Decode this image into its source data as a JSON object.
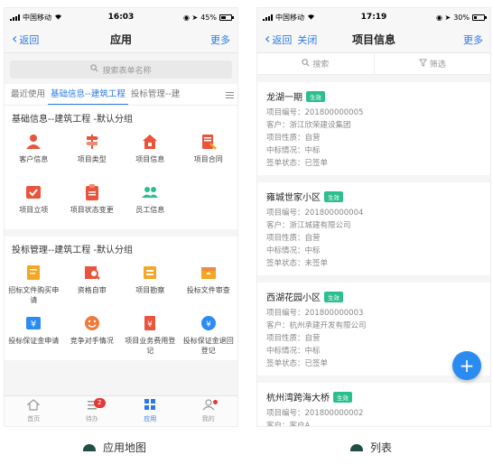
{
  "left": {
    "status": {
      "carrier": "中国移动",
      "time": "16:03",
      "battery": "45%",
      "battery_level": 0.45
    },
    "nav": {
      "back": "返回",
      "title": "应用",
      "more": "更多"
    },
    "search_placeholder": "搜索表单名称",
    "tabs": [
      "最近使用",
      "基础信息--建筑工程",
      "投标管理--建"
    ],
    "section1": {
      "title": "基础信息--建筑工程 -默认分组",
      "items": [
        "客户信息",
        "项目类型",
        "项目信息",
        "项目合同",
        "项目立项",
        "项目状态变更",
        "员工信息"
      ]
    },
    "section2": {
      "title": "投标管理--建筑工程 -默认分组",
      "items": [
        "招标文件购买申请",
        "资格自审",
        "项目勘察",
        "投标文件审查",
        "投标保证金申请",
        "竞争对手情况",
        "项目业务费用登记",
        "投标保证金退回登记"
      ]
    },
    "tabbar": [
      {
        "label": "首页",
        "badge": ""
      },
      {
        "label": "待办",
        "badge": "2"
      },
      {
        "label": "应用",
        "badge": ""
      },
      {
        "label": "我的",
        "badge": ""
      }
    ],
    "caption": "应用地图"
  },
  "right": {
    "status": {
      "carrier": "中国移动",
      "time": "17:19",
      "battery": "30%",
      "battery_level": 0.3
    },
    "nav": {
      "back": "返回",
      "close": "关闭",
      "title": "项目信息",
      "more": "更多"
    },
    "search": "搜索",
    "filter": "筛选",
    "tag": "生效",
    "records": [
      {
        "name": "龙湖一期",
        "rows": [
          "项目编号：201800000005",
          "客户：浙江欣荣建设集团",
          "项目性质：自营",
          "中标情况：中标",
          "签单状态：已签单"
        ]
      },
      {
        "name": "雍城世家小区",
        "rows": [
          "项目编号：201800000004",
          "客户：浙江城建有限公司",
          "项目性质：自营",
          "中标情况：中标",
          "签单状态：未签单"
        ]
      },
      {
        "name": "西湖花园小区",
        "rows": [
          "项目编号：201800000003",
          "客户：杭州承建开发有限公司",
          "项目性质：自营",
          "中标情况：中标",
          "签单状态：已签单"
        ]
      },
      {
        "name": "杭州湾跨海大桥",
        "rows": [
          "项目编号：201800000002",
          "客户：客户A"
        ]
      }
    ],
    "fab": "+",
    "caption": "列表"
  },
  "colors": {
    "accent": "#2a7ae2",
    "tag": "#2bbf8e",
    "badge": "#e53935"
  }
}
